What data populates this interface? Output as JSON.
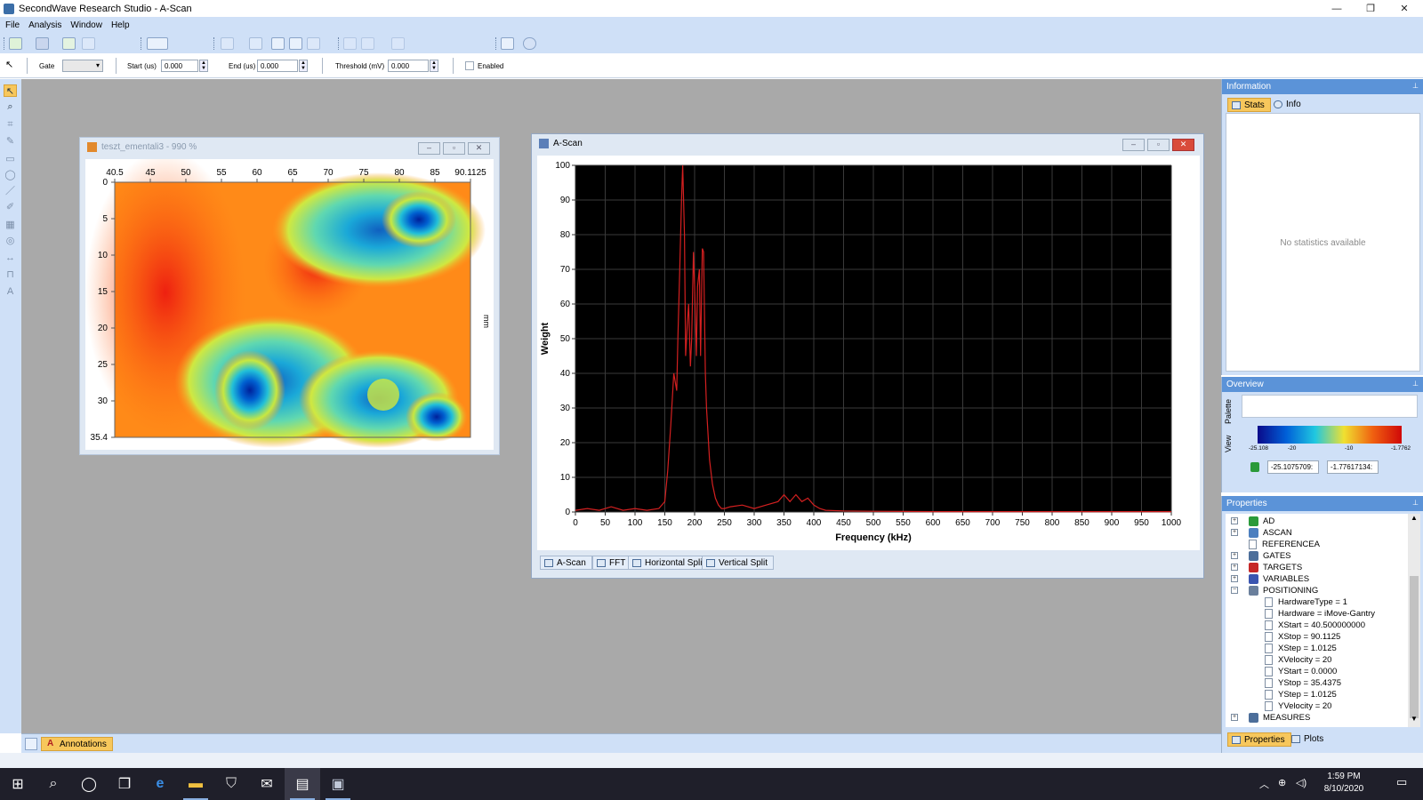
{
  "window": {
    "title": "SecondWave Research Studio - A-Scan",
    "controls": [
      "—",
      "❐",
      "✕"
    ]
  },
  "menu": [
    "File",
    "Analysis",
    "Window",
    "Help"
  ],
  "toolbar2": {
    "gate_label": "Gate",
    "start_label": "Start (us)",
    "start_value": "0.000",
    "end_label": "End (us)",
    "end_value": "0.000",
    "threshold_label": "Threshold (mV)",
    "threshold_value": "0.000",
    "enabled_label": "Enabled"
  },
  "heatmap_window": {
    "title": "teszt_ementali3 - 990 %",
    "x_ticks": [
      "40.5",
      "45",
      "50",
      "55",
      "60",
      "65",
      "70",
      "75",
      "80",
      "85",
      "90.1125"
    ],
    "y_ticks": [
      "0",
      "5",
      "10",
      "15",
      "20",
      "25",
      "30",
      "35.4"
    ],
    "y_unit": "mm"
  },
  "ascan_window": {
    "title": "A-Scan",
    "tabs": [
      "A-Scan",
      "FFT",
      "Horizontal Split",
      "Vertical Split"
    ]
  },
  "chart_data": {
    "type": "line",
    "xlabel": "Frequency (kHz)",
    "ylabel": "Weight",
    "xlim": [
      0,
      1000
    ],
    "ylim": [
      0,
      100
    ],
    "x_ticks": [
      0,
      50,
      100,
      150,
      200,
      250,
      300,
      350,
      400,
      450,
      500,
      550,
      600,
      650,
      700,
      750,
      800,
      850,
      900,
      950,
      1000
    ],
    "y_ticks": [
      0,
      10,
      20,
      30,
      40,
      50,
      60,
      70,
      80,
      90,
      100
    ],
    "grid": true,
    "series": [
      {
        "color": "#d42020",
        "x": [
          0,
          20,
          40,
          60,
          80,
          100,
          120,
          140,
          150,
          155,
          160,
          165,
          170,
          172,
          175,
          178,
          180,
          183,
          185,
          188,
          190,
          193,
          195,
          198,
          200,
          203,
          205,
          208,
          210,
          213,
          215,
          218,
          220,
          225,
          230,
          235,
          240,
          245,
          250,
          260,
          280,
          300,
          320,
          340,
          350,
          360,
          370,
          380,
          390,
          400,
          410,
          420,
          450,
          500,
          600,
          700,
          800,
          900,
          1000
        ],
        "y": [
          0.5,
          1,
          0.5,
          1.5,
          0.5,
          1,
          0.5,
          1,
          3,
          12,
          25,
          40,
          35,
          50,
          70,
          90,
          100,
          80,
          45,
          55,
          60,
          42,
          50,
          75,
          65,
          45,
          65,
          70,
          45,
          76,
          75,
          40,
          30,
          15,
          8,
          4,
          2,
          1,
          1,
          1.5,
          2,
          1,
          2,
          3,
          5,
          3,
          5,
          3,
          4,
          2,
          1,
          0.5,
          0.3,
          0.2,
          0.1,
          0.1,
          0.1,
          0.1,
          0.1
        ]
      }
    ]
  },
  "information_panel": {
    "title": "Information",
    "tabs": [
      "Stats",
      "Info"
    ],
    "empty_text": "No statistics available"
  },
  "overview_panel": {
    "title": "Overview",
    "side_tabs": [
      "Palette",
      "View"
    ],
    "scale_labels": [
      "-25.108",
      "-20",
      "-10",
      "-1.7762"
    ],
    "min_value": "-25.1075709:",
    "max_value": "-1.77617134:"
  },
  "properties_panel": {
    "title": "Properties",
    "nodes": [
      {
        "label": "AD",
        "expanded": false
      },
      {
        "label": "ASCAN",
        "expanded": false
      },
      {
        "label": "REFERENCEA",
        "leaf": true
      },
      {
        "label": "GATES",
        "expanded": false
      },
      {
        "label": "TARGETS",
        "expanded": false
      },
      {
        "label": "VARIABLES",
        "expanded": false
      },
      {
        "label": "POSITIONING",
        "expanded": true
      }
    ],
    "positioning_items": [
      "HardwareType = 1",
      "Hardware = iMove-Gantry",
      "XStart = 40.500000000",
      "XStop = 90.1125",
      "XStep = 1.0125",
      "XVelocity = 20",
      "YStart = 0.0000",
      "YStop = 35.4375",
      "YStep = 1.0125",
      "YVelocity = 20"
    ],
    "last_node": "MEASURES",
    "bottom_tabs": [
      "Properties",
      "Plots"
    ]
  },
  "annotations_tab": "Annotations",
  "taskbar": {
    "time": "1:59 PM",
    "date": "8/10/2020"
  },
  "colors": {
    "accent": "#5b93d8",
    "toolbar_bg": "#cfe0f7",
    "workspace": "#a9a9a9",
    "plot_bg": "#000000",
    "trace": "#d42020"
  }
}
